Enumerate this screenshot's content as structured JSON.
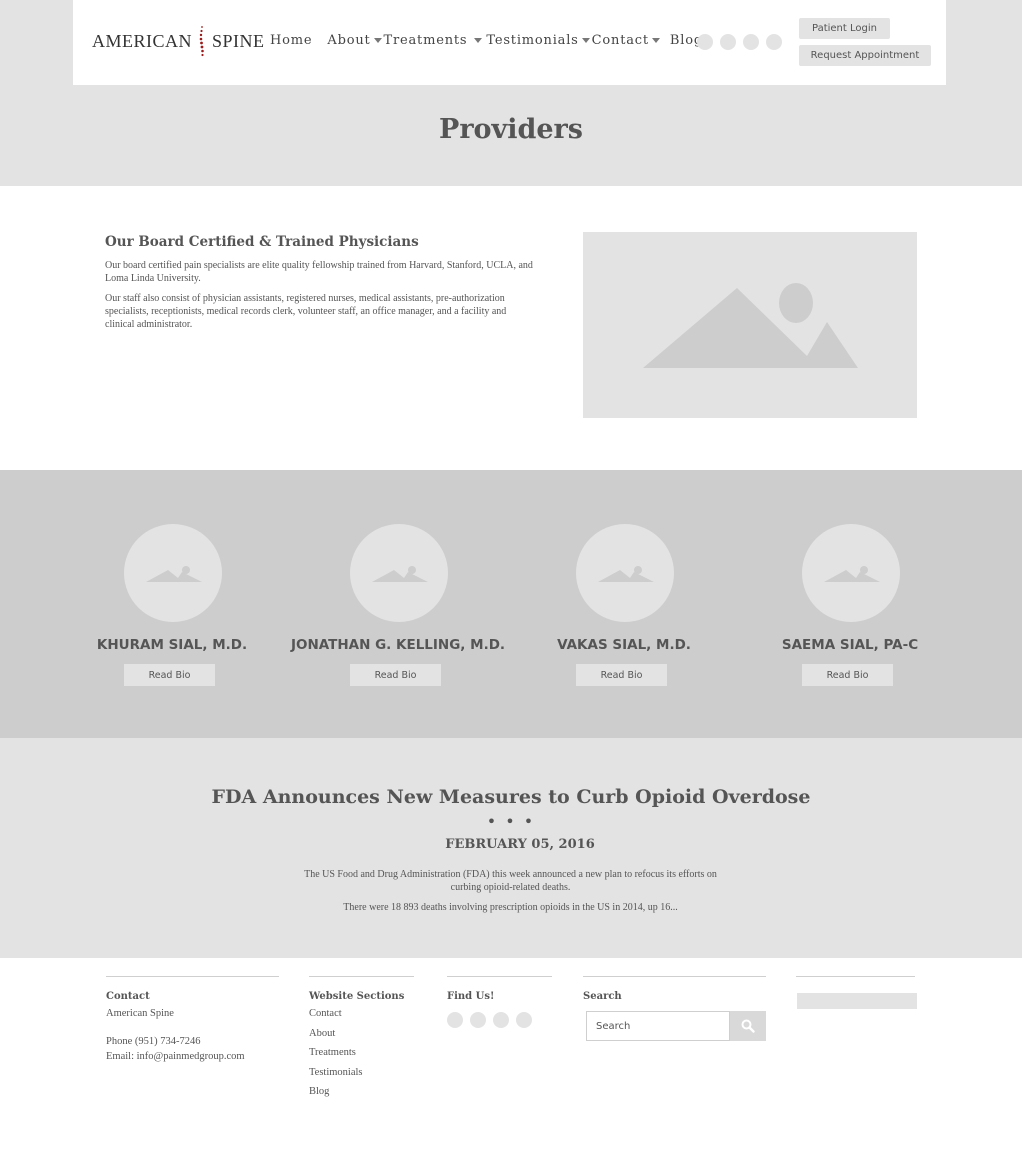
{
  "header": {
    "logo_left": "AMERICAN",
    "logo_right": "SPINE",
    "nav": [
      {
        "label": "Home",
        "has_dropdown": false
      },
      {
        "label": "About",
        "has_dropdown": true
      },
      {
        "label": "Treatments",
        "has_dropdown": true
      },
      {
        "label": "Testimonials",
        "has_dropdown": true
      },
      {
        "label": "Contact",
        "has_dropdown": true
      },
      {
        "label": "Blog",
        "has_dropdown": false
      }
    ],
    "social_icons": [
      "social-icon",
      "social-icon",
      "social-icon",
      "social-icon"
    ],
    "login_label": "Patient Login",
    "appointment_label": "Request Appointment"
  },
  "page": {
    "title": "Providers"
  },
  "intro": {
    "heading": "Our Board Certified & Trained Physicians",
    "paragraph1": "Our board certified pain specialists are elite quality fellowship trained from Harvard, Stanford, UCLA, and Loma Linda University.",
    "paragraph2": "Our staff also consist of physician assistants, registered nurses, medical assistants, pre-authorization specialists, receptionists, medical records clerk, volunteer staff, an office manager, and a facility and clinical administrator."
  },
  "providers": [
    {
      "name": "KHURAM SIAL, M.D.",
      "button": "Read Bio"
    },
    {
      "name": "JONATHAN G. KELLING, M.D.",
      "button": "Read Bio"
    },
    {
      "name": "VAKAS SIAL, M.D.",
      "button": "Read Bio"
    },
    {
      "name": "SAEMA SIAL, PA-C",
      "button": "Read Bio"
    }
  ],
  "news": {
    "title": "FDA Announces New Measures to Curb Opioid Overdose",
    "separator": "• • •",
    "date": "FEBRUARY 05, 2016",
    "paragraph1": "The US Food and Drug Administration (FDA) this week announced a new plan to refocus its efforts on curbing opioid-related deaths.",
    "paragraph2": "There were 18 893 deaths involving prescription opioids in the US in 2014, up 16..."
  },
  "footer": {
    "contact": {
      "heading": "Contact",
      "name": "American Spine",
      "phone": "Phone (951) 734-7246",
      "email": "Email: info@painmedgroup.com"
    },
    "sections": {
      "heading": "Website Sections",
      "links": [
        "Contact",
        "About",
        "Treatments",
        "Testimonials",
        "Blog"
      ]
    },
    "find_us": {
      "heading": "Find Us!"
    },
    "search": {
      "heading": "Search",
      "placeholder": "Search"
    }
  },
  "colors": {
    "band_light": "#e3e3e3",
    "band_dark": "#cdcdcd",
    "text": "#555555",
    "logo_accent": "#9b1c1c"
  }
}
